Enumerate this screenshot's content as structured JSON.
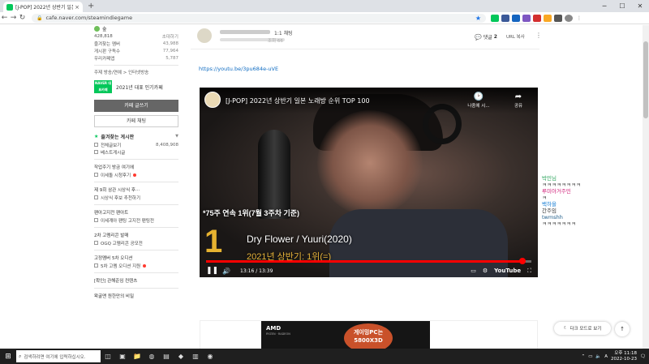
{
  "browser": {
    "tab_title": "[J-POP] 2022년 상반기 일본",
    "tab_close": "×",
    "new_tab": "+",
    "url": "cafe.naver.com/steamindiegame",
    "win_min": "─",
    "win_max": "☐",
    "win_close": "✕"
  },
  "sidebar": {
    "top_badge": "숲",
    "stats": [
      {
        "label": "428,818",
        "value": "초대하기"
      },
      {
        "label": "즐겨찾는 멤버",
        "value": "43,988"
      },
      {
        "label": "게시판 구독수",
        "value": "77,964"
      },
      {
        "label": "우리카페앱",
        "value": "5,787"
      }
    ],
    "topic": "주제  방송/연예 > 인터넷방송",
    "popular_badge": "NAVER 대표카페",
    "popular_text": "2021년 대표 인기카페",
    "write_button": "카페 글쓰기",
    "chat_button": "카페 채팅",
    "favorites_title": "즐겨찾는 게시판",
    "menu": [
      {
        "label": "전체글보기",
        "count": "8,408,908"
      },
      {
        "label": "베스트게시글",
        "count": ""
      }
    ],
    "cats": [
      {
        "head": "작업주기 방금 여기에",
        "item": "이세돌 시청후기",
        "dot": true
      },
      {
        "head": "제 9회 삼관 시상식 후···",
        "item": "시상식 후보 추천하기",
        "dot": false
      },
      {
        "head": "팬아고지전 팬아트",
        "item": "이세계아 팬팅 고지전 팬팅전",
        "dot": false
      },
      {
        "head": "2차 고멤리콘 발매",
        "item": "OGQ 고멤리콘 공모전",
        "dot": false
      },
      {
        "head": "고정멤버 5차 오디션",
        "item": "5차 고멤 오디션 지원",
        "dot": true
      }
    ],
    "extra1": "[확인] 관해준임 컨텐츠",
    "extra2": "왁굴맨 원한만의 비밀"
  },
  "article": {
    "title_suffix": "1:1 채팅",
    "views": "조회 66",
    "comments_label": "댓글",
    "comments_count": "2",
    "url_copy": "URL 복사",
    "link": "https://youtu.be/3pu684e-uVE"
  },
  "video": {
    "title": "[J-POP] 2022년 상반기 일본 노래방 순위 TOP 100",
    "watch_later": "나중에 시...",
    "share": "공유",
    "caption_top": "*75주 연속 1위(7월 3주차 기준)",
    "rank": "1",
    "song": "Dry Flower / Yuuri(2020)",
    "song_sub": "2021년 상반기: 1위(=)",
    "time": "13:16 / 13:39",
    "progress": 0.972,
    "youtube": "YouTube"
  },
  "ad": {
    "brand": "AMD",
    "brand_sub": "RYZEN · RADEON",
    "promo": "게이밍PC는 5800X3D"
  },
  "chat": [
    {
      "text": "박민님",
      "color": "#2aa35a"
    },
    {
      "text": "ㅋㅋㅋㅋㅋㅋㅋㅋ",
      "color": "#333333"
    },
    {
      "text": "루미아거주민",
      "color": "#d0207a"
    },
    {
      "text": "ㅋ",
      "color": "#333333"
    },
    {
      "text": "백하을",
      "color": "#1a7fd4"
    },
    {
      "text": "간주임",
      "color": "#333333"
    },
    {
      "text": "twmshh",
      "color": "#1f5d8a"
    },
    {
      "text": "ㅋㅋㅋㅋㅋㅋㅋ",
      "color": "#333333"
    }
  ],
  "dark_mode": "다크 모드로 보기",
  "to_top": "↑",
  "taskbar": {
    "search_placeholder": "검색하려면 여기에 입력하십시오.",
    "time": "오후 11:18",
    "date": "2022-10-23",
    "lang": "A"
  }
}
